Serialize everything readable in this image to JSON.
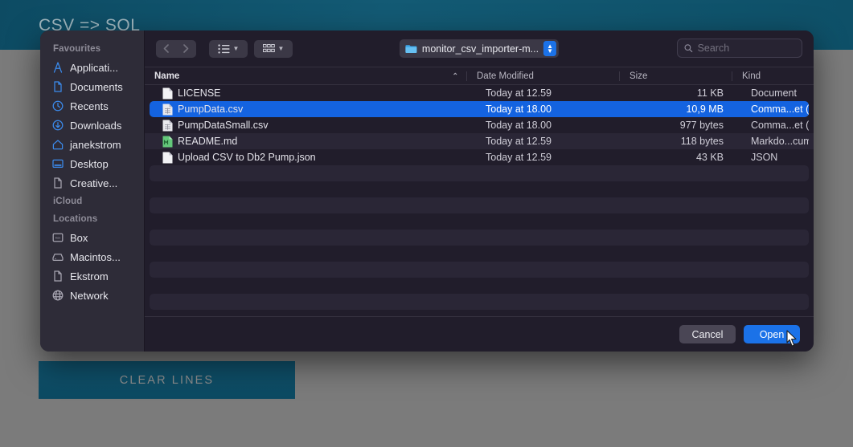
{
  "background_app": {
    "title": "CSV => SQL",
    "clear_button_label": "CLEAR LINES",
    "header_color": "#0f546c"
  },
  "dialog": {
    "toolbar": {
      "back_label": "Back",
      "forward_label": "Forward",
      "view_mode_label": "List view",
      "group_mode_label": "Group by",
      "path_label": "monitor_csv_importer-m...",
      "search_placeholder": "Search",
      "search_value": ""
    },
    "columns": [
      {
        "key": "name",
        "label": "Name",
        "sorted": "ascending",
        "sort_glyph": "⌃"
      },
      {
        "key": "date",
        "label": "Date Modified"
      },
      {
        "key": "size",
        "label": "Size"
      },
      {
        "key": "kind",
        "label": "Kind"
      }
    ],
    "files": [
      {
        "name": "LICENSE",
        "date": "Today at 12.59",
        "size": "11 KB",
        "kind": "Document",
        "icon": "document-icon",
        "selected": false
      },
      {
        "name": "PumpData.csv",
        "date": "Today at 18.00",
        "size": "10,9 MB",
        "kind": "Comma...et (.csv)",
        "icon": "csv-icon",
        "selected": true
      },
      {
        "name": "PumpDataSmall.csv",
        "date": "Today at 18.00",
        "size": "977 bytes",
        "kind": "Comma...et (.csv)",
        "icon": "csv-icon",
        "selected": false
      },
      {
        "name": "README.md",
        "date": "Today at 12.59",
        "size": "118 bytes",
        "kind": "Markdo...cument",
        "icon": "markdown-icon",
        "selected": false
      },
      {
        "name": "Upload CSV to Db2 Pump.json",
        "date": "Today at 12.59",
        "size": "43 KB",
        "kind": "JSON",
        "icon": "document-icon",
        "selected": false
      }
    ],
    "footer": {
      "cancel_label": "Cancel",
      "open_label": "Open"
    },
    "accent_color": "#1b72e8",
    "selection_color": "#1463e0"
  },
  "sidebar": {
    "groups": [
      {
        "title": "Favourites",
        "items": [
          {
            "label": "Applicati...",
            "icon": "applications-icon",
            "tint": "blue"
          },
          {
            "label": "Documents",
            "icon": "documents-icon",
            "tint": "blue"
          },
          {
            "label": "Recents",
            "icon": "clock-icon",
            "tint": "blue"
          },
          {
            "label": "Downloads",
            "icon": "downloads-icon",
            "tint": "blue"
          },
          {
            "label": "janekstrom",
            "icon": "home-icon",
            "tint": "blue"
          },
          {
            "label": "Desktop",
            "icon": "desktop-icon",
            "tint": "blue"
          },
          {
            "label": "Creative...",
            "icon": "folder-doc-icon",
            "tint": "grey"
          }
        ]
      },
      {
        "title": "iCloud",
        "items": []
      },
      {
        "title": "Locations",
        "items": [
          {
            "label": "Box",
            "icon": "box-icon",
            "tint": "grey"
          },
          {
            "label": "Macintos...",
            "icon": "harddisk-icon",
            "tint": "grey"
          },
          {
            "label": "Ekstrom",
            "icon": "folder-doc-icon",
            "tint": "grey"
          },
          {
            "label": "Network",
            "icon": "globe-icon",
            "tint": "grey"
          }
        ]
      }
    ]
  }
}
